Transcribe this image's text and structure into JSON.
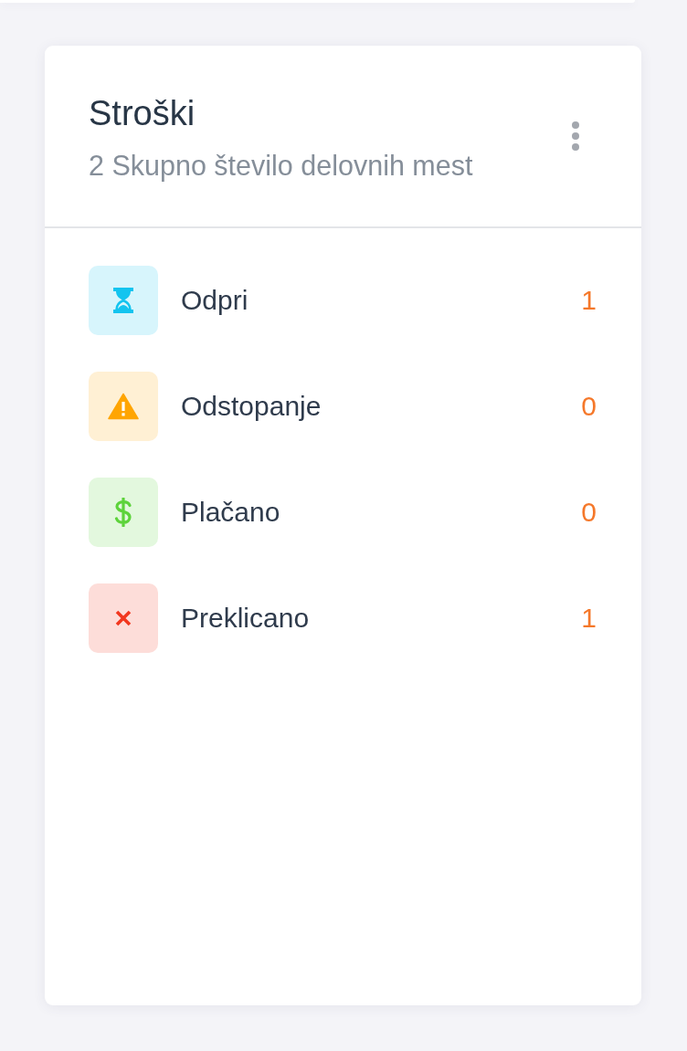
{
  "card": {
    "title": "Stroški",
    "subtitle": "2 Skupno število delovnih mest"
  },
  "statuses": [
    {
      "kind": "pending",
      "label": "Odpri",
      "count": "1",
      "color": "#13c4ef"
    },
    {
      "kind": "warning",
      "label": "Odstopanje",
      "count": "0",
      "color": "#ffa502"
    },
    {
      "kind": "paid",
      "label": "Plačano",
      "count": "0",
      "color": "#5dd33b"
    },
    {
      "kind": "cancelled",
      "label": "Preklicano",
      "count": "1",
      "color": "#f2371f"
    }
  ]
}
